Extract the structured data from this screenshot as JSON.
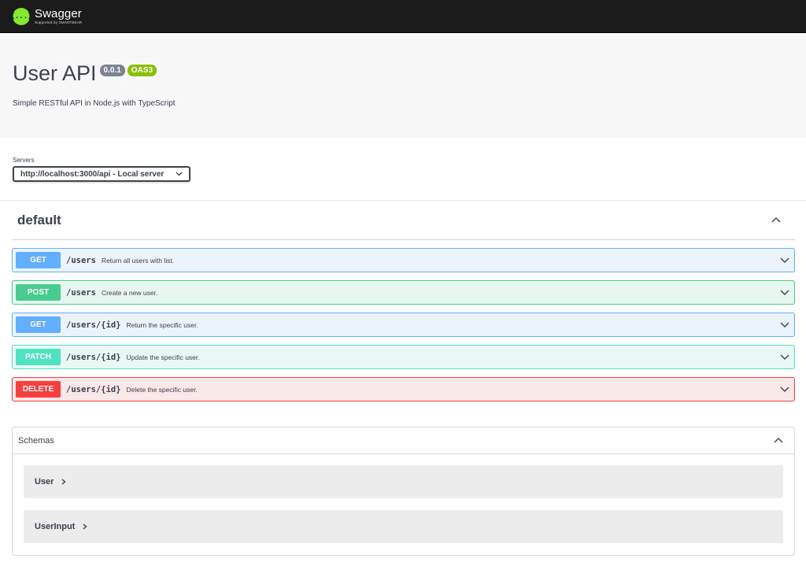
{
  "brand": {
    "name": "Swagger",
    "sub": "Supported by SMARTBEAR",
    "mark": "{...}"
  },
  "info": {
    "title": "User API",
    "version": "0.0.1",
    "oas": "OAS3",
    "description": "Simple RESTful API in Node.js with TypeScript"
  },
  "servers": {
    "label": "Servers",
    "selected": "http://localhost:3000/api - Local server"
  },
  "tag": {
    "name": "default"
  },
  "operations": [
    {
      "method": "GET",
      "path": "/users",
      "summary": "Return all users with list."
    },
    {
      "method": "POST",
      "path": "/users",
      "summary": "Create a new user."
    },
    {
      "method": "GET",
      "path": "/users/{id}",
      "summary": "Return the specific user."
    },
    {
      "method": "PATCH",
      "path": "/users/{id}",
      "summary": "Update the specific user."
    },
    {
      "method": "DELETE",
      "path": "/users/{id}",
      "summary": "Delete the specific user."
    }
  ],
  "schemas": {
    "title": "Schemas",
    "items": [
      {
        "name": "User"
      },
      {
        "name": "UserInput"
      }
    ]
  },
  "colors": {
    "get": "#61affe",
    "post": "#49cc90",
    "patch": "#50e3c2",
    "delete": "#f93e3e",
    "topbar": "#1b1b1b",
    "logo": "#85ea2d"
  }
}
